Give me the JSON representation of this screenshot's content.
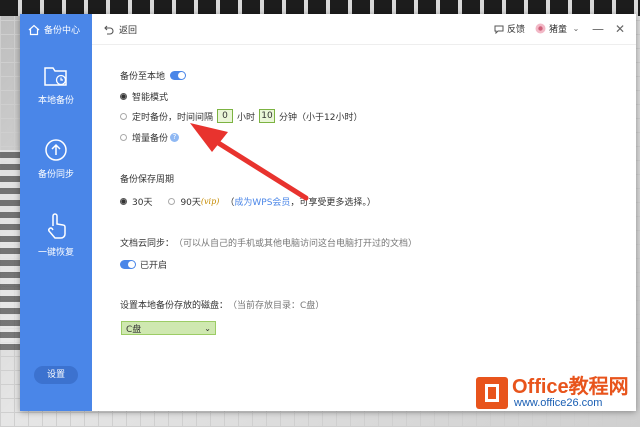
{
  "sidebar": {
    "brand": "备份中心",
    "items": [
      {
        "label": "本地备份",
        "icon": "folder-clock-icon"
      },
      {
        "label": "备份同步",
        "icon": "cloud-upload-icon"
      },
      {
        "label": "一键恢复",
        "icon": "hand-pointer-icon"
      }
    ],
    "settings": "设置"
  },
  "topbar": {
    "back": "返回",
    "feedback": "反馈",
    "user": "猪童"
  },
  "local_backup": {
    "title": "备份至本地",
    "toggle_on": true,
    "smart_mode": "智能模式",
    "timed_label": "定时备份，时间间隔",
    "interval_hours": "0",
    "hours_unit": "小时",
    "interval_minutes": "10",
    "minutes_unit": "分钟（小于12小时）",
    "incremental": "增量备份"
  },
  "retention": {
    "title": "备份保存周期",
    "opt30": "30天",
    "opt90": "90天",
    "vip": "(vip)",
    "paren_open": "（",
    "member_link": "成为WPS会员",
    "member_tail": "，可享受更多选择。）"
  },
  "cloud_sync": {
    "title": "文档云同步：",
    "desc": "（可以从自己的手机或其他电脑访问这台电脑打开过的文档）",
    "status": "已开启"
  },
  "disk": {
    "title": "设置本地备份存放的磁盘：",
    "current": "（当前存放目录：C盘）",
    "selected": "C盘"
  },
  "watermark": {
    "brand": "Office教程网",
    "url": "www.office26.com"
  },
  "colors": {
    "accent": "#4a86e8",
    "arrow": "#e8332e",
    "logo": "#e8541c"
  }
}
